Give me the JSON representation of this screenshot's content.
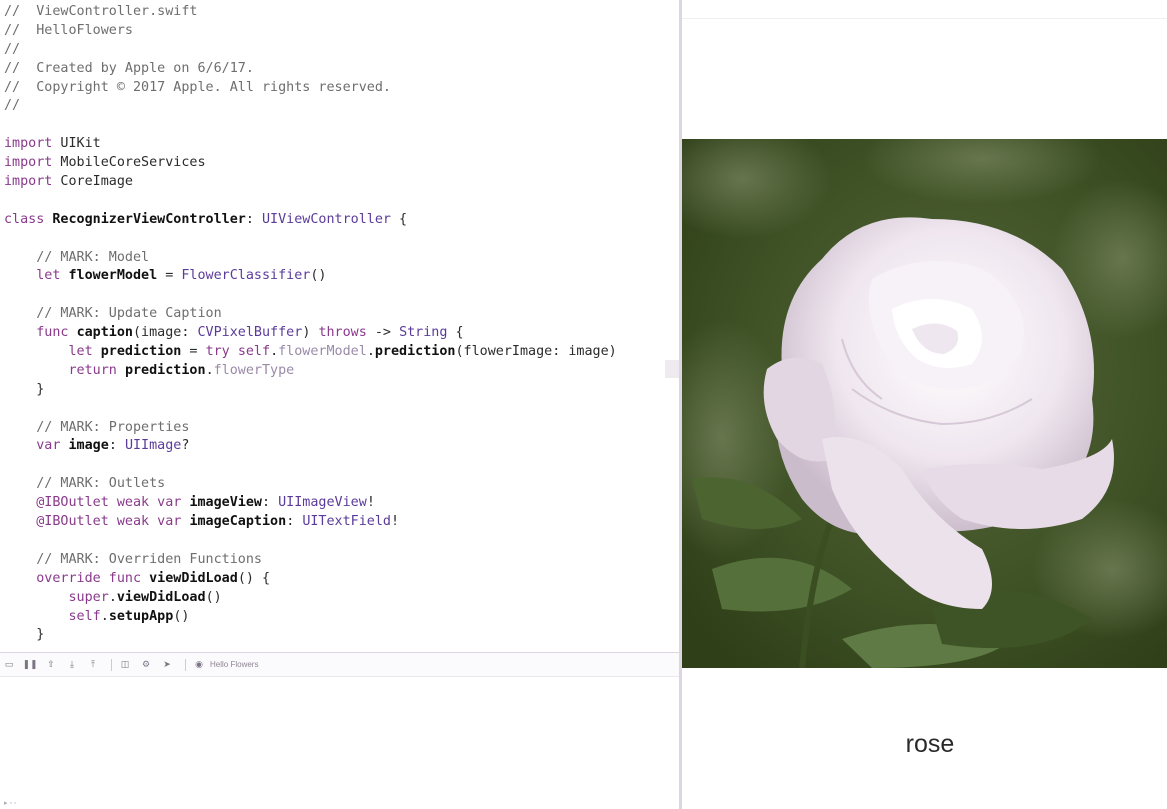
{
  "colors": {
    "comment": "#6e6e6e",
    "keyword": "#8a3a8c",
    "type": "#5b3b9a",
    "identifier": "#111111",
    "member": "#9a8aa8",
    "image_background": "#3a4d20",
    "petal": "#e8dde8"
  },
  "editor": {
    "lines": [
      [
        [
          "comment",
          "//  ViewController.swift"
        ]
      ],
      [
        [
          "comment",
          "//  HelloFlowers"
        ]
      ],
      [
        [
          "comment",
          "//"
        ]
      ],
      [
        [
          "comment",
          "//  Created by Apple on 6/6/17."
        ]
      ],
      [
        [
          "comment",
          "//  Copyright © 2017 Apple. All rights reserved."
        ]
      ],
      [
        [
          "comment",
          "//"
        ]
      ],
      [],
      [
        [
          "keyword",
          "import"
        ],
        [
          "plain",
          " UIKit"
        ]
      ],
      [
        [
          "keyword",
          "import"
        ],
        [
          "plain",
          " MobileCoreServices"
        ]
      ],
      [
        [
          "keyword",
          "import"
        ],
        [
          "plain",
          " CoreImage"
        ]
      ],
      [],
      [
        [
          "keyword",
          "class"
        ],
        [
          "plain",
          " "
        ],
        [
          "ident",
          "RecognizerViewController"
        ],
        [
          "plain",
          ": "
        ],
        [
          "type",
          "UIViewController"
        ],
        [
          "plain",
          " {"
        ]
      ],
      [],
      [
        [
          "plain",
          "    "
        ],
        [
          "comment",
          "// MARK: Model"
        ]
      ],
      [
        [
          "plain",
          "    "
        ],
        [
          "keyword",
          "let"
        ],
        [
          "plain",
          " "
        ],
        [
          "ident",
          "flowerModel"
        ],
        [
          "plain",
          " = "
        ],
        [
          "type",
          "FlowerClassifier"
        ],
        [
          "plain",
          "()"
        ]
      ],
      [],
      [
        [
          "plain",
          "    "
        ],
        [
          "comment",
          "// MARK: Update Caption"
        ]
      ],
      [
        [
          "plain",
          "    "
        ],
        [
          "keyword",
          "func"
        ],
        [
          "plain",
          " "
        ],
        [
          "ident",
          "caption"
        ],
        [
          "plain",
          "(image: "
        ],
        [
          "type",
          "CVPixelBuffer"
        ],
        [
          "plain",
          ") "
        ],
        [
          "keyword",
          "throws"
        ],
        [
          "plain",
          " -> "
        ],
        [
          "type",
          "String"
        ],
        [
          "plain",
          " {"
        ]
      ],
      [
        [
          "plain",
          "        "
        ],
        [
          "keyword",
          "let"
        ],
        [
          "plain",
          " "
        ],
        [
          "ident",
          "prediction"
        ],
        [
          "plain",
          " = "
        ],
        [
          "keyword",
          "try"
        ],
        [
          "plain",
          " "
        ],
        [
          "keyword",
          "self"
        ],
        [
          "plain",
          "."
        ],
        [
          "member",
          "flowerModel"
        ],
        [
          "plain",
          "."
        ],
        [
          "ident",
          "prediction"
        ],
        [
          "plain",
          "(flowerImage: image)"
        ]
      ],
      [
        [
          "plain",
          "        "
        ],
        [
          "keyword",
          "return"
        ],
        [
          "plain",
          " "
        ],
        [
          "ident",
          "prediction"
        ],
        [
          "plain",
          "."
        ],
        [
          "member",
          "flowerType"
        ]
      ],
      [
        [
          "plain",
          "    }"
        ]
      ],
      [],
      [
        [
          "plain",
          "    "
        ],
        [
          "comment",
          "// MARK: Properties"
        ]
      ],
      [
        [
          "plain",
          "    "
        ],
        [
          "keyword",
          "var"
        ],
        [
          "plain",
          " "
        ],
        [
          "ident",
          "image"
        ],
        [
          "plain",
          ": "
        ],
        [
          "type",
          "UIImage"
        ],
        [
          "plain",
          "?"
        ]
      ],
      [],
      [
        [
          "plain",
          "    "
        ],
        [
          "comment",
          "// MARK: Outlets"
        ]
      ],
      [
        [
          "plain",
          "    "
        ],
        [
          "keyword",
          "@IBOutlet weak var"
        ],
        [
          "plain",
          " "
        ],
        [
          "ident",
          "imageView"
        ],
        [
          "plain",
          ": "
        ],
        [
          "type",
          "UIImageView"
        ],
        [
          "plain",
          "!"
        ]
      ],
      [
        [
          "plain",
          "    "
        ],
        [
          "keyword",
          "@IBOutlet weak var"
        ],
        [
          "plain",
          " "
        ],
        [
          "ident",
          "imageCaption"
        ],
        [
          "plain",
          ": "
        ],
        [
          "type",
          "UITextField"
        ],
        [
          "plain",
          "!"
        ]
      ],
      [],
      [
        [
          "plain",
          "    "
        ],
        [
          "comment",
          "// MARK: Overriden Functions"
        ]
      ],
      [
        [
          "plain",
          "    "
        ],
        [
          "keyword",
          "override func"
        ],
        [
          "plain",
          " "
        ],
        [
          "ident",
          "viewDidLoad"
        ],
        [
          "plain",
          "() {"
        ]
      ],
      [
        [
          "plain",
          "        "
        ],
        [
          "keyword",
          "super"
        ],
        [
          "plain",
          "."
        ],
        [
          "ident",
          "viewDidLoad"
        ],
        [
          "plain",
          "()"
        ]
      ],
      [
        [
          "plain",
          "        "
        ],
        [
          "keyword",
          "self"
        ],
        [
          "plain",
          "."
        ],
        [
          "ident",
          "setupApp"
        ],
        [
          "plain",
          "()"
        ]
      ],
      [
        [
          "plain",
          "    }"
        ]
      ]
    ]
  },
  "debug_bar": {
    "buttons": [
      {
        "name": "hide-debug-area-icon",
        "glyph": "▭"
      },
      {
        "name": "pause-icon",
        "glyph": "❚❚"
      },
      {
        "name": "continue-icon",
        "glyph": "⇧"
      },
      {
        "name": "step-over-icon",
        "glyph": "⤓"
      },
      {
        "name": "step-into-icon",
        "glyph": "⤒"
      },
      {
        "name": "view-hierarchy-icon",
        "glyph": "◫"
      },
      {
        "name": "memory-graph-icon",
        "glyph": "⚙"
      },
      {
        "name": "location-icon",
        "glyph": "➤"
      }
    ],
    "scheme_label": "Hello Flowers"
  },
  "simulator": {
    "caption": "rose"
  }
}
